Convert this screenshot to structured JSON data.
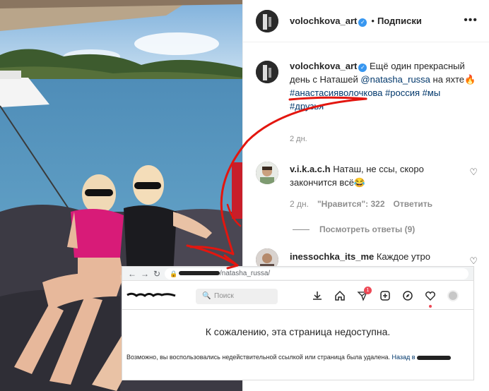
{
  "post": {
    "username": "volochkova_art",
    "separator": "•",
    "follow_label": "Подписки",
    "more_label": "•••"
  },
  "caption": {
    "username": "volochkova_art",
    "text_1": "Ещё один прекрасный день с Наташей",
    "mention": "@natasha_russa",
    "text_2": "на яхте🔥",
    "hashtags": [
      "#анастасияволочкова",
      "#россия",
      "#мы",
      "#друзья"
    ],
    "time": "2 дн."
  },
  "comments": [
    {
      "username": "v.i.k.a.c.h",
      "text": "Наташ, не ссы, скоро закончится всё😂",
      "time": "2 дн.",
      "likes": "\"Нравится\": 322",
      "reply_label": "Ответить",
      "view_replies": "Посмотреть ответы (9)"
    },
    {
      "username": "inessochka_its_me",
      "text": "Каждое утро"
    }
  ],
  "browser": {
    "back": "←",
    "forward": "→",
    "reload": "↻",
    "url_suffix": "/natasha_russa/",
    "search_placeholder": "Поиск",
    "notifications_badge": "1",
    "error_title": "К сожалению, эта страница недоступна.",
    "error_text": "Возможно, вы воспользовались недействительной ссылкой или страница была удалена.",
    "back_link": "Назад в"
  },
  "colors": {
    "link": "#00376b",
    "verified": "#3897f0",
    "annotation": "#e3160f",
    "badge": "#ed4956"
  }
}
